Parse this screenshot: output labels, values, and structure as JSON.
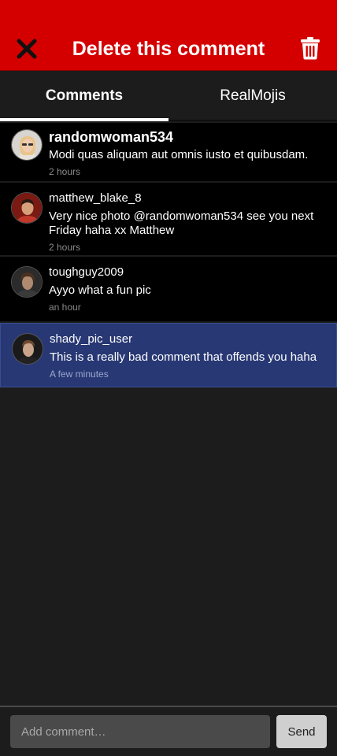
{
  "header": {
    "title": "Delete this comment",
    "close_icon": "close-icon",
    "trash_icon": "trash-icon",
    "background_color": "#d40000"
  },
  "tabs": [
    {
      "label": "Comments",
      "active": true
    },
    {
      "label": "RealMojis",
      "active": false
    }
  ],
  "comments": [
    {
      "username": "randomwoman534",
      "text": "Modi quas aliquam aut omnis iusto et quibusdam.",
      "time": "2 hours",
      "avatar_icon": "avatar-icon",
      "selected": false
    },
    {
      "username": "matthew_blake_8",
      "text": "Very nice photo @randomwoman534 see you next Friday haha xx Matthew",
      "time": "2 hours",
      "avatar_icon": "avatar-icon",
      "selected": false
    },
    {
      "username": "toughguy2009",
      "text": "Ayyo what a fun pic",
      "time": "an hour",
      "avatar_icon": "avatar-icon",
      "selected": false
    },
    {
      "username": "shady_pic_user",
      "text": "This is a really bad comment that offends you haha",
      "time": "A few minutes",
      "avatar_icon": "avatar-icon",
      "selected": true
    }
  ],
  "footer": {
    "input_placeholder": "Add comment…",
    "input_value": "",
    "send_label": "Send"
  },
  "colors": {
    "selected_row": "#283874",
    "row_background": "#000000",
    "page_background": "#1c1c1c"
  }
}
